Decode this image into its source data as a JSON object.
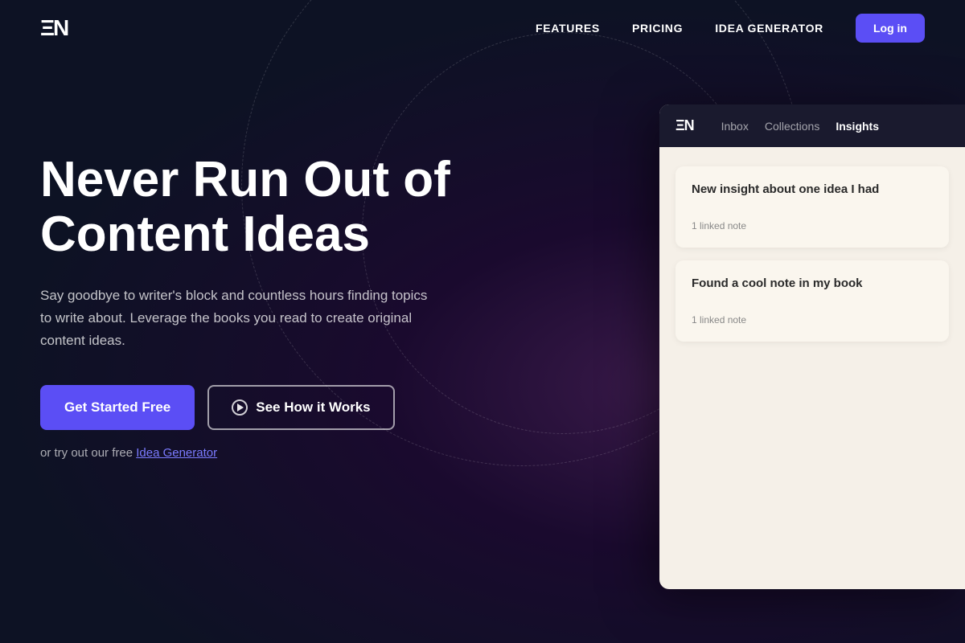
{
  "brand": {
    "logo_text": "ΞN",
    "logo_alt": "TEN logo"
  },
  "nav": {
    "features_label": "FEATURES",
    "pricing_label": "PRICING",
    "idea_generator_label": "IDEA GENERATOR",
    "login_label": "Log in"
  },
  "hero": {
    "title_line1": "Never Run Out of",
    "title_line2": "Content Ideas",
    "subtitle": "Say goodbye to writer's block and countless hours finding topics to write about. Leverage the books you read to create original content ideas.",
    "cta_primary": "Get Started Free",
    "cta_secondary": "See How it Works",
    "note_prefix": "or try out our free ",
    "note_link": "Idea Generator"
  },
  "app_preview": {
    "logo": "ΞN",
    "nav_items": [
      {
        "label": "Inbox",
        "active": false
      },
      {
        "label": "Collections",
        "active": false
      },
      {
        "label": "Insights",
        "active": true
      }
    ],
    "cards": [
      {
        "title": "New insight about one idea I had",
        "linked_note": "1 linked note"
      },
      {
        "title": "Found a cool note in my book",
        "linked_note": "1 linked note"
      }
    ]
  },
  "colors": {
    "accent": "#5b4ef5",
    "link": "#7b7bff",
    "bg_dark": "#0d1224",
    "card_bg": "#faf6ee"
  }
}
